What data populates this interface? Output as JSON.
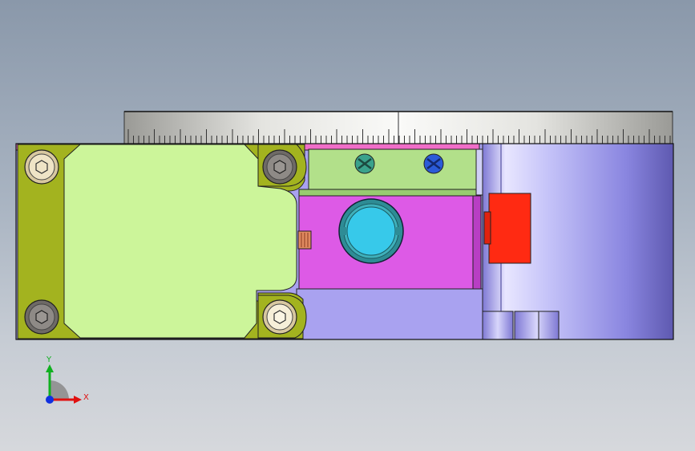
{
  "viewport": {
    "name": "cad-graphics-area",
    "background_top": "#8a98aa",
    "background_bottom": "#d6d8dc"
  },
  "model": {
    "colors": {
      "scale_ring": "#d9d9d6",
      "base_plate": "#a9a2f0",
      "sensor_body": "#ccf59a",
      "sensor_bracket": "#a3b31f",
      "block": "#dd5ae6",
      "green_clamp": "#b2e08a",
      "pink_strip": "#f06ec8",
      "cylinder_light": "#d8d6fb",
      "cylinder_dark": "#5e59b0",
      "red_block": "#ff2a12",
      "bore_cyan": "#37c9ea",
      "bore_ring": "#2e8c95",
      "screw_teal": "#3aa28c",
      "screw_blue": "#2b5bd8"
    }
  },
  "triad": {
    "x_label": "X",
    "y_label": "Y",
    "x_color": "#e01010",
    "y_color": "#10b020",
    "z_color": "#1030e0"
  }
}
